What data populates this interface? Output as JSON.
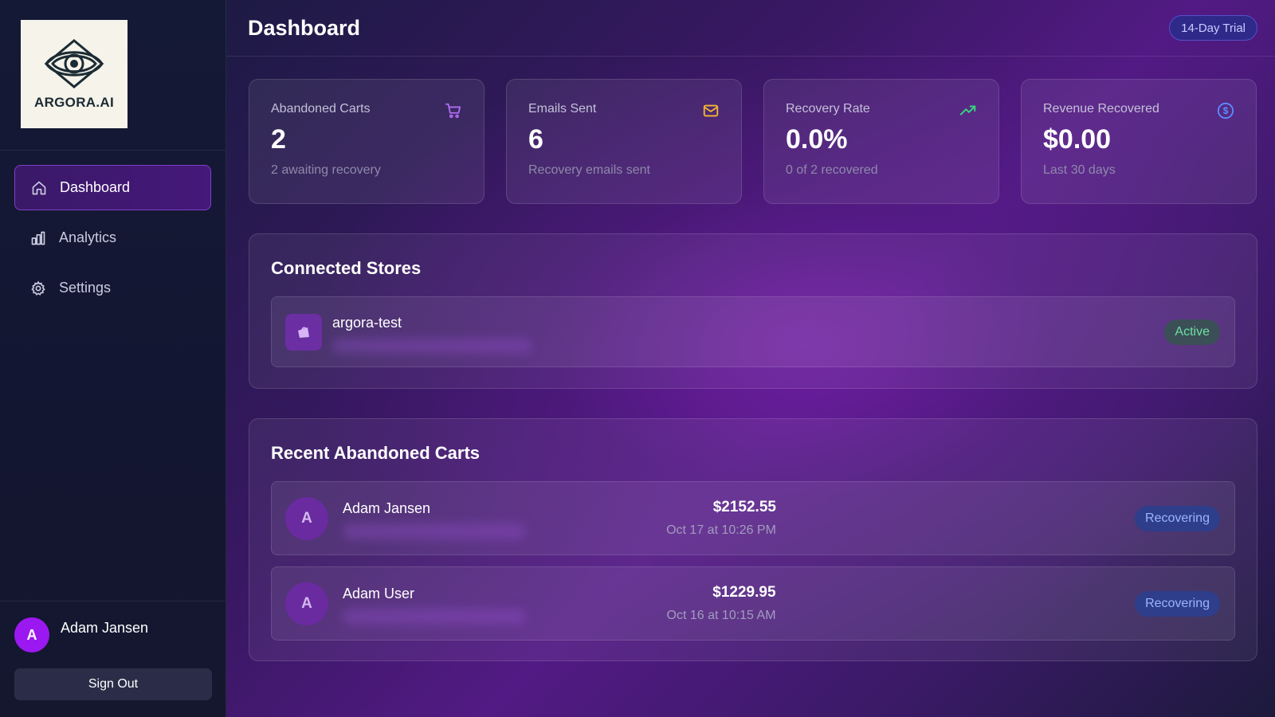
{
  "sidebar": {
    "logo_text": "ARGORA.AI",
    "nav": [
      {
        "label": "Dashboard",
        "icon": "home-icon",
        "active": true
      },
      {
        "label": "Analytics",
        "icon": "bar-chart-icon",
        "active": false
      },
      {
        "label": "Settings",
        "icon": "gear-icon",
        "active": false
      }
    ],
    "user": {
      "initial": "A",
      "name": "Adam Jansen"
    },
    "signout_label": "Sign Out"
  },
  "header": {
    "title": "Dashboard",
    "trial_badge": "14-Day Trial"
  },
  "stats": [
    {
      "label": "Abandoned Carts",
      "value": "2",
      "sub": "2 awaiting recovery",
      "icon": "cart-icon",
      "color": "#b06cf5"
    },
    {
      "label": "Emails Sent",
      "value": "6",
      "sub": "Recovery emails sent",
      "icon": "mail-icon",
      "color": "#f5b731"
    },
    {
      "label": "Recovery Rate",
      "value": "0.0%",
      "sub": "0 of 2 recovered",
      "icon": "trending-up-icon",
      "color": "#36d27f"
    },
    {
      "label": "Revenue Recovered",
      "value": "$0.00",
      "sub": "Last 30 days",
      "icon": "dollar-icon",
      "color": "#5b8cff"
    }
  ],
  "stores": {
    "title": "Connected Stores",
    "items": [
      {
        "name": "argora-test",
        "status": "Active",
        "icon": "shopify-bag-icon"
      }
    ]
  },
  "carts": {
    "title": "Recent Abandoned Carts",
    "items": [
      {
        "initial": "A",
        "name": "Adam Jansen",
        "amount": "$2152.55",
        "date": "Oct 17 at 10:26 PM",
        "status": "Recovering"
      },
      {
        "initial": "A",
        "name": "Adam User",
        "amount": "$1229.95",
        "date": "Oct 16 at 10:15 AM",
        "status": "Recovering"
      }
    ]
  },
  "colors": {
    "accent": "#9b19f0",
    "active_status": "#6fe0a1",
    "recovering_status": "#9cb4ff"
  }
}
